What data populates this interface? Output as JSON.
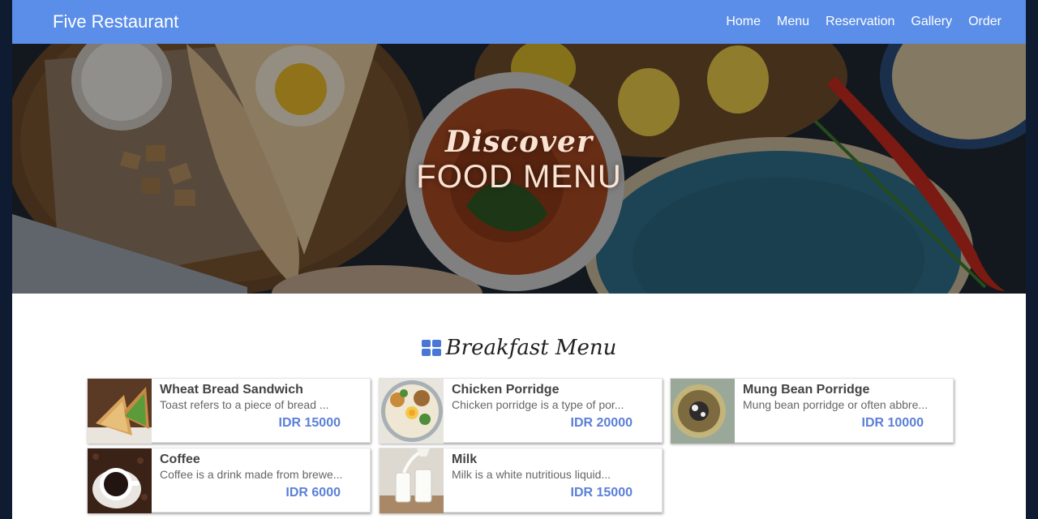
{
  "brand": "Five Restaurant",
  "nav": [
    "Home",
    "Menu",
    "Reservation",
    "Gallery",
    "Order"
  ],
  "hero": {
    "subtitle": "Discover",
    "title": "FOOD MENU"
  },
  "section": {
    "icon": "grid-icon",
    "title": "Breakfast Menu"
  },
  "menu_items": [
    {
      "name": "Wheat Bread Sandwich",
      "description": "Toast refers to a piece of bread ...",
      "price": "IDR 15000",
      "image": "sandwich"
    },
    {
      "name": "Chicken Porridge",
      "description": "Chicken porridge is a type of por...",
      "price": "IDR 20000",
      "image": "chicken-porridge"
    },
    {
      "name": "Mung Bean Porridge",
      "description": "Mung bean porridge or often abbre...",
      "price": "IDR 10000",
      "image": "mung-bean-porridge"
    },
    {
      "name": "Coffee",
      "description": "Coffee is a drink made from brewe...",
      "price": "IDR 6000",
      "image": "coffee"
    },
    {
      "name": "Milk",
      "description": "Milk is a white nutritious liquid...",
      "price": "IDR 15000",
      "image": "milk"
    }
  ],
  "colors": {
    "navbar": "#5b8ee8",
    "price": "#5b7fd8",
    "page_bg": "#0f1b30"
  }
}
